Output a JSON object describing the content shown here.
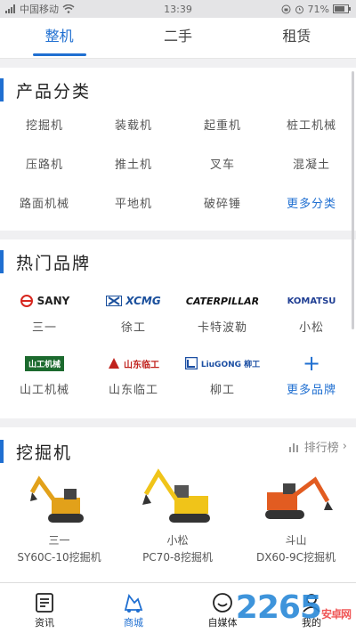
{
  "statusbar": {
    "carrier": "中国移动",
    "time": "13:39",
    "battery": "71%"
  },
  "tabs": [
    {
      "label": "整机",
      "active": true
    },
    {
      "label": "二手",
      "active": false
    },
    {
      "label": "租赁",
      "active": false
    }
  ],
  "categories": {
    "title": "产品分类",
    "items": [
      "挖掘机",
      "装载机",
      "起重机",
      "桩工机械",
      "压路机",
      "推土机",
      "叉车",
      "混凝土",
      "路面机械",
      "平地机",
      "破碎锤"
    ],
    "more": "更多分类"
  },
  "brands": {
    "title": "热门品牌",
    "items": [
      {
        "name": "三一",
        "logo": "SANY",
        "color": "#d7261e"
      },
      {
        "name": "徐工",
        "logo": "XCMG",
        "color": "#1a4f9c"
      },
      {
        "name": "卡特波勒",
        "logo": "CATERPILLAR",
        "color": "#111111"
      },
      {
        "name": "小松",
        "logo": "KOMATSU",
        "color": "#1f3e93"
      },
      {
        "name": "山工机械",
        "logo": "山工机械",
        "color": "#1c6a2e"
      },
      {
        "name": "山东临工",
        "logo": "山东临工",
        "color": "#c0221d"
      },
      {
        "name": "柳工",
        "logo": "LiuGONG 柳工",
        "color": "#1c4fa3"
      }
    ],
    "more": "更多品牌"
  },
  "excavators": {
    "title": "挖掘机",
    "rank_label": "排行榜",
    "products": [
      {
        "brand": "三一",
        "model": "SY60C-10挖掘机",
        "color": "#e2a11a"
      },
      {
        "brand": "小松",
        "model": "PC70-8挖掘机",
        "color": "#f0c419"
      },
      {
        "brand": "斗山",
        "model": "DX60-9C挖掘机",
        "color": "#e25c21"
      }
    ]
  },
  "bottomnav": [
    {
      "label": "资讯",
      "icon": "news-icon",
      "active": false
    },
    {
      "label": "商城",
      "icon": "mall-icon",
      "active": true
    },
    {
      "label": "自媒体",
      "icon": "media-icon",
      "active": false
    },
    {
      "label": "我的",
      "icon": "profile-icon",
      "active": false
    }
  ],
  "watermark": {
    "text": "2265",
    "sub": "安卓网"
  }
}
